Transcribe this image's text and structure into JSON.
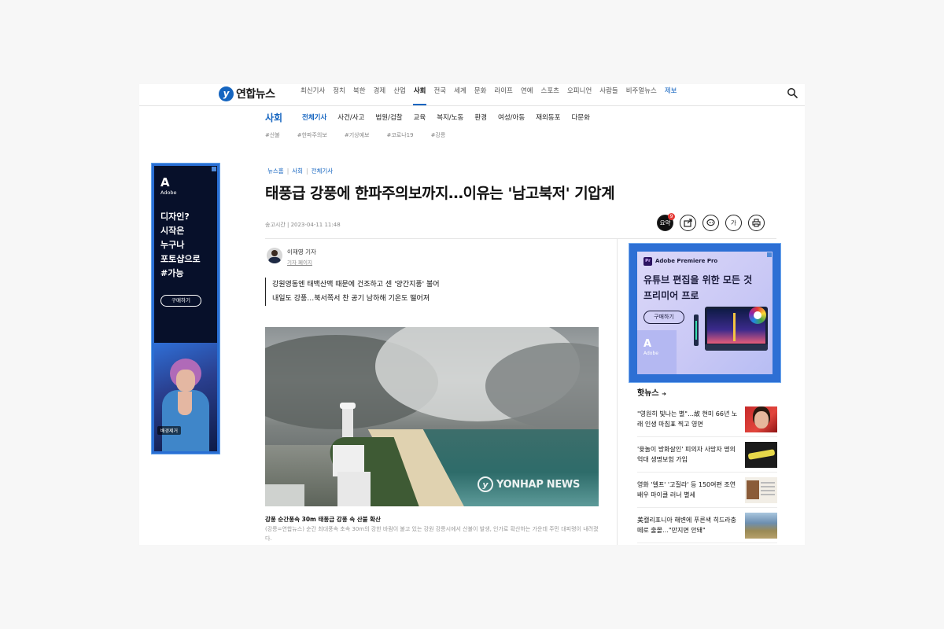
{
  "header": {
    "logo_mark": "y",
    "logo_text": "연합뉴스",
    "menu": [
      {
        "label": "최신기사",
        "state": ""
      },
      {
        "label": "정치",
        "state": ""
      },
      {
        "label": "북한",
        "state": ""
      },
      {
        "label": "경제",
        "state": ""
      },
      {
        "label": "산업",
        "state": ""
      },
      {
        "label": "사회",
        "state": "active"
      },
      {
        "label": "전국",
        "state": ""
      },
      {
        "label": "세계",
        "state": ""
      },
      {
        "label": "문화",
        "state": ""
      },
      {
        "label": "라이프",
        "state": ""
      },
      {
        "label": "연예",
        "state": ""
      },
      {
        "label": "스포츠",
        "state": ""
      },
      {
        "label": "오피니언",
        "state": ""
      },
      {
        "label": "사람들",
        "state": ""
      },
      {
        "label": "비주얼뉴스",
        "state": ""
      },
      {
        "label": "제보",
        "state": "blue"
      }
    ]
  },
  "section": {
    "title": "사회",
    "menu": [
      {
        "label": "전체기사",
        "state": "active"
      },
      {
        "label": "사건/사고",
        "state": ""
      },
      {
        "label": "법원/검찰",
        "state": ""
      },
      {
        "label": "교육",
        "state": ""
      },
      {
        "label": "복지/노동",
        "state": ""
      },
      {
        "label": "환경",
        "state": ""
      },
      {
        "label": "여성/아동",
        "state": ""
      },
      {
        "label": "재외동포",
        "state": ""
      },
      {
        "label": "다문화",
        "state": ""
      }
    ],
    "tags": [
      "#산불",
      "#한파주의보",
      "#기상예보",
      "#코로나19",
      "#강릉"
    ]
  },
  "left_ad": {
    "brand": "Adobe",
    "copy_line1": "디자인?",
    "copy_line2": "시작은",
    "copy_line3": "누구나",
    "copy_line4": "포토샵으로",
    "copy_line5": "#가능",
    "button": "구매하기",
    "image_tag": "배경제거"
  },
  "article": {
    "breadcrumb": [
      "뉴스홈",
      "사회",
      "전체기사"
    ],
    "title": "태풍급 강풍에 한파주의보까지…이유는 '남고북저' 기압계",
    "published": "송고시간 | 2023-04-11 11:48",
    "tools": {
      "summary": "요약",
      "summary_badge": "9",
      "font": "가"
    },
    "author_name": "이재영 기자",
    "author_page": "기자 페이지",
    "summary": [
      "강원영동엔 태백산맥 때문에 건조하고 센 '양간지풍' 불어",
      "내일도 강풍…북서쪽서 찬 공기 남하해 기온도 떨어져"
    ],
    "photo_watermark_mark": "y",
    "photo_watermark": "YONHAP NEWS",
    "caption_title": "강풍 순간풍속 30m 태풍급 강풍 속 산불 확산",
    "caption_body": "(강릉=연합뉴스) 순간 최대풍속 초속 30m의 강한 바람이 불고 있는 강원 강릉시에서 산불이 발생, 인가로 확산하는 가운데 주민 대피령이 내려졌다."
  },
  "right_ad": {
    "badge": "Pr",
    "product": "Adobe Premiere Pro",
    "copy_line1": "유튜브 편집을 위한 모든 것",
    "copy_line2": "프리미어 프로",
    "button": "구매하기",
    "brand": "Adobe"
  },
  "hot_news": {
    "title": "핫뉴스",
    "items": [
      {
        "text": "\"영원히 빛나는 별\"…故 현미 66년 노래 인생 마침표 찍고 영면"
      },
      {
        "text": "'윷놀이 방화살인' 피의자 사망자 명의 억대 생명보험 가입"
      },
      {
        "text": "영화 '엘프' '고질라' 등 150여편 조연배우 마이클 러너 별세"
      },
      {
        "text": "美캘리포니아 해변에 푸른색 히드라충 떼로 출몰…\"만지면 안돼\""
      }
    ]
  },
  "colors": {
    "accent": "#1565c0",
    "ad_frame": "#2d6fd4"
  }
}
